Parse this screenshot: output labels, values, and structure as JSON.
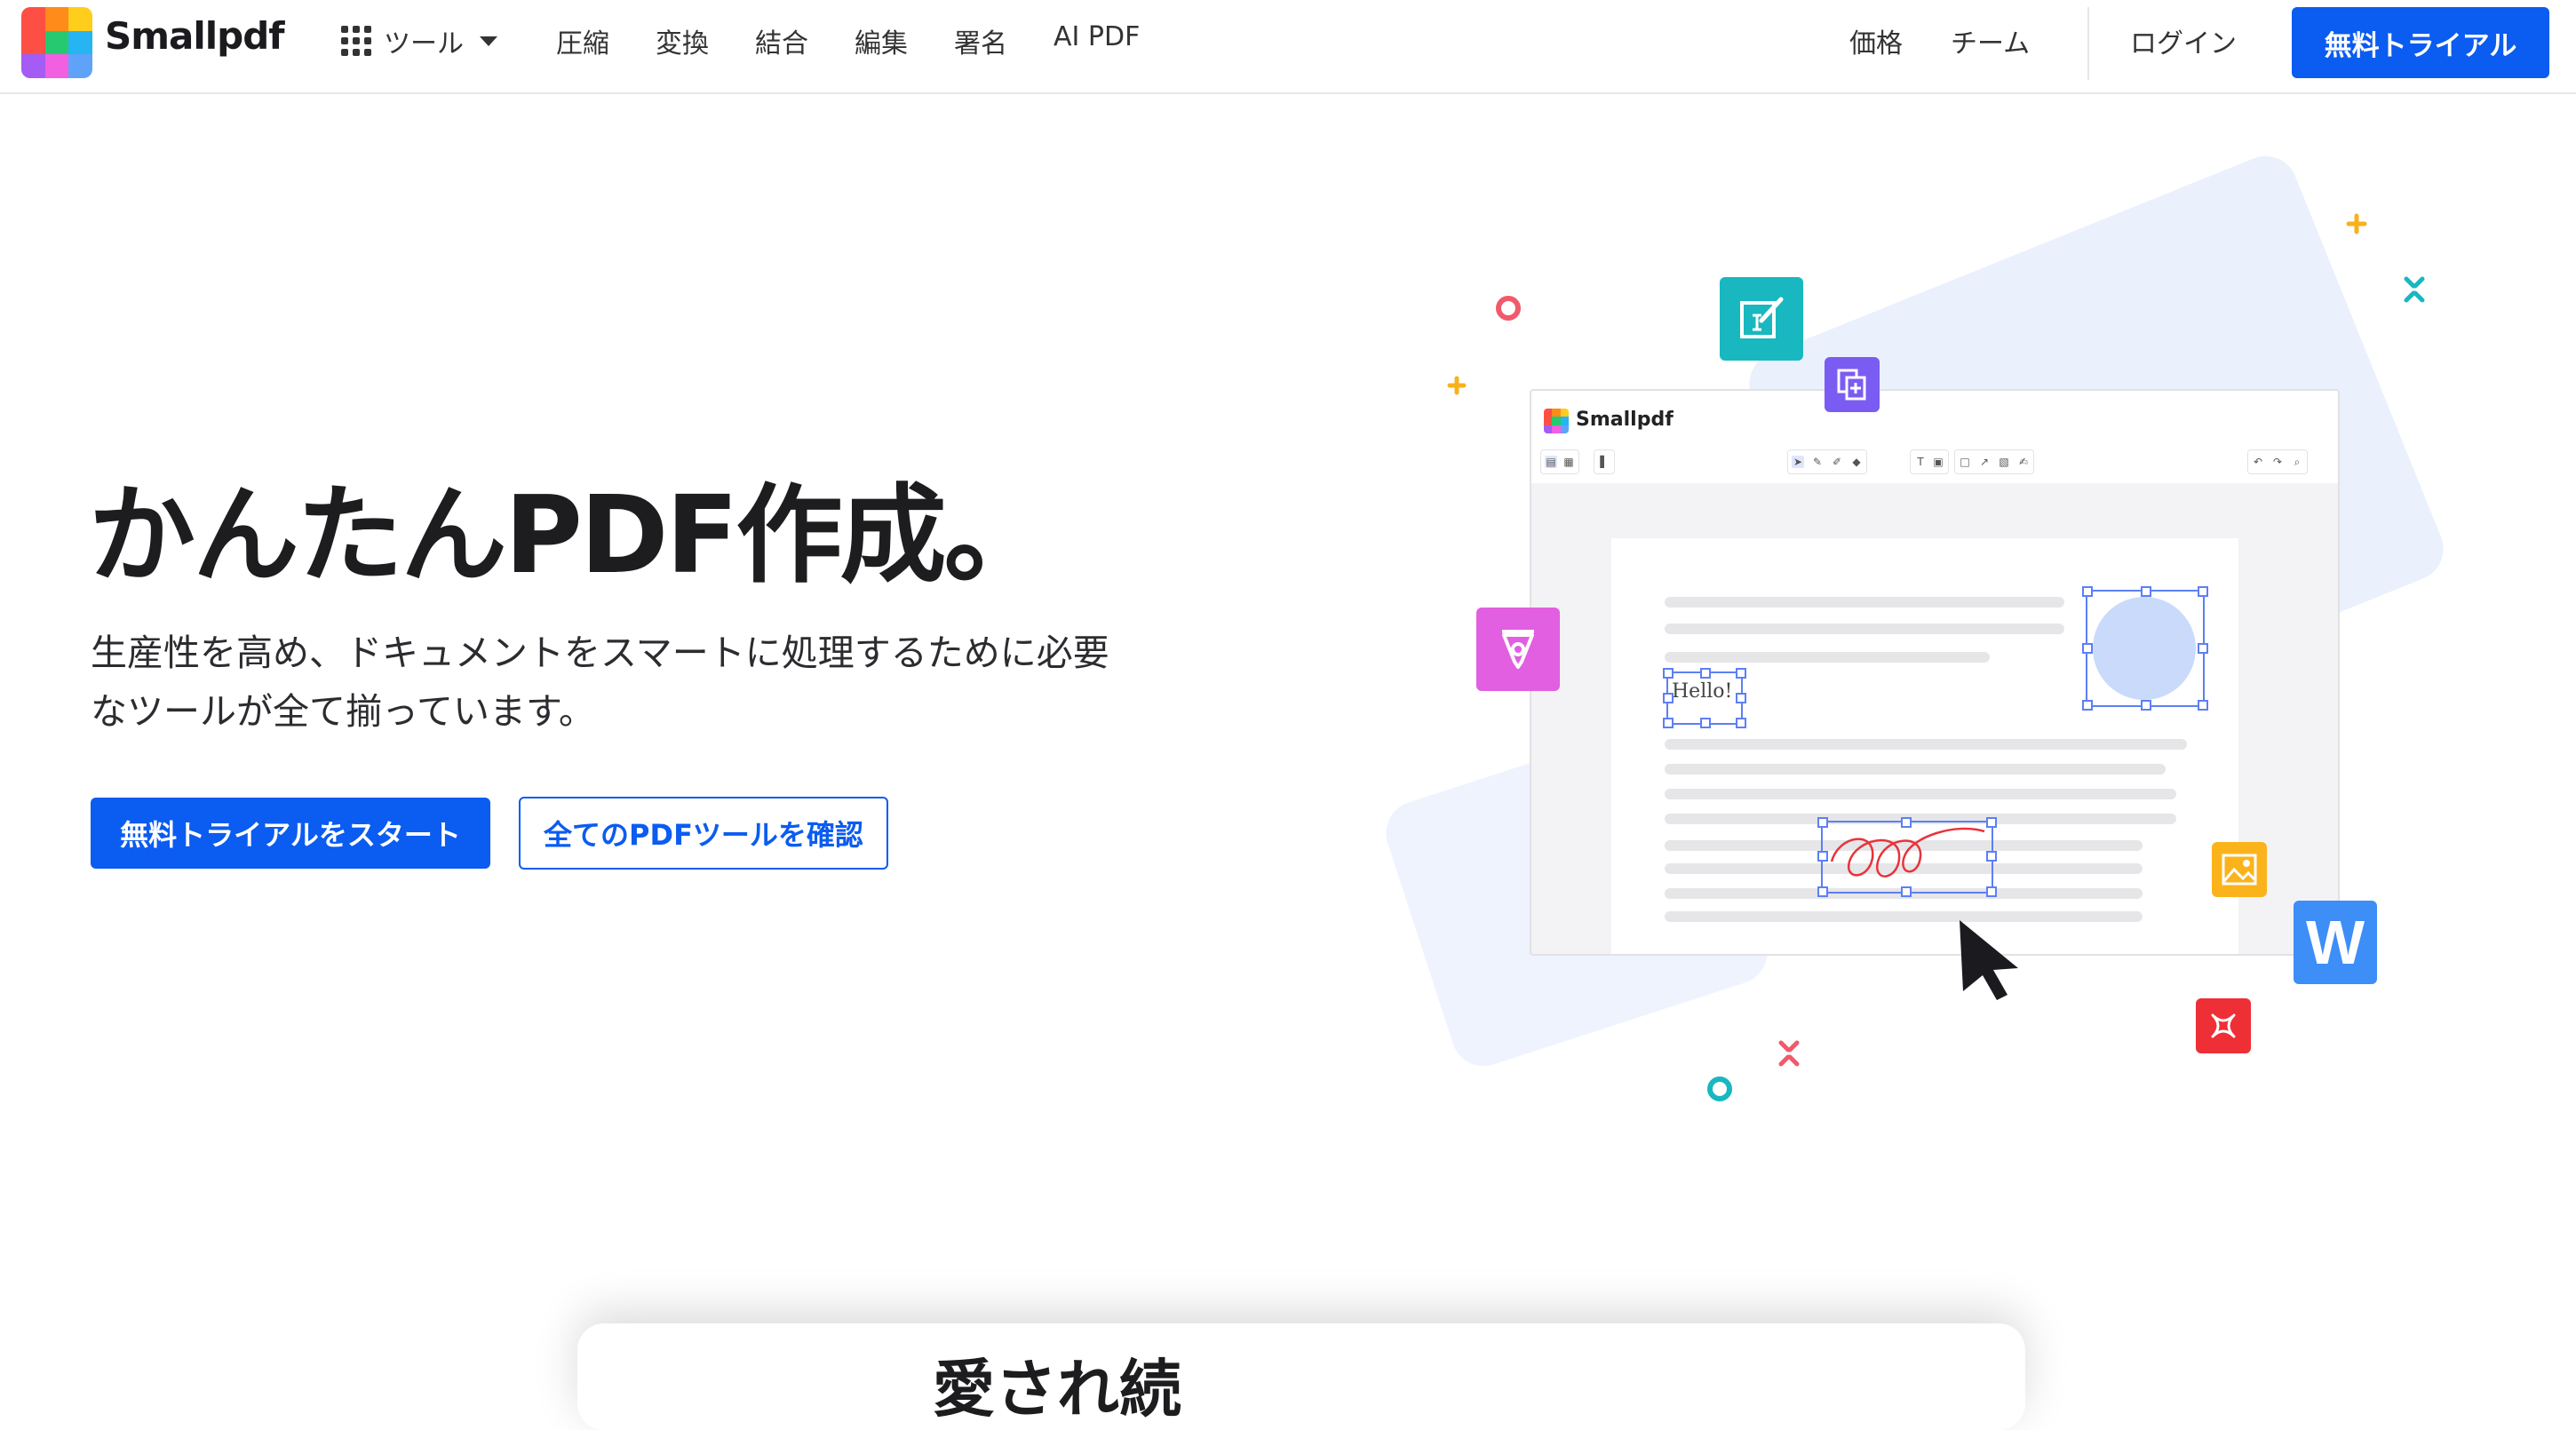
{
  "header": {
    "brand": "Smallpdf",
    "tools_label": "ツール",
    "nav": [
      "圧縮",
      "変換",
      "結合",
      "編集",
      "署名",
      "AI PDF"
    ],
    "pricing": "価格",
    "team": "チーム",
    "login": "ログイン",
    "trial": "無料トライアル"
  },
  "hero": {
    "title": "かんたんPDF作成。",
    "subtitle_line1": "生産性を高め、ドキュメントをスマートに処理するために必要",
    "subtitle_line2": "なツールが全て揃っています。",
    "cta_primary": "無料トライアルをスタート",
    "cta_secondary": "全てのPDFツールを確認"
  },
  "illustration": {
    "app_brand": "Smallpdf",
    "hello_text": "Hello!",
    "word_tile_letter": "W",
    "colors": {
      "teal": "#19b7c0",
      "purple": "#7b5cf2",
      "pink": "#e15fe0",
      "yellow": "#fbb31b",
      "blue": "#3d8ef7",
      "red": "#ee2f35",
      "selection": "#5d7ff5"
    }
  },
  "bottom": {
    "partial_title": "愛され続"
  },
  "colors": {
    "accent": "#0b5cf0",
    "logo": [
      "#fe4f45",
      "#ff8b1a",
      "#ffcd1c",
      "#fe4f45",
      "#26c96f",
      "#26b4f2",
      "#a45cf5",
      "#f25fe0",
      "#5ea3f9"
    ]
  }
}
